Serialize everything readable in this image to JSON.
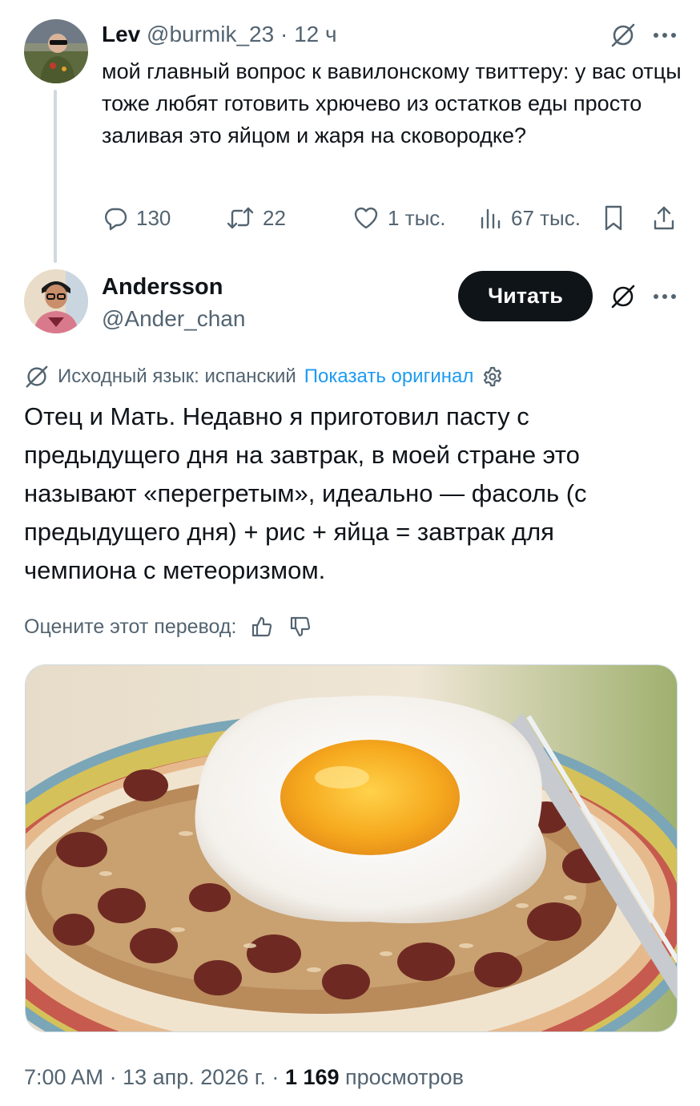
{
  "tweet1": {
    "author_name": "Lev",
    "author_handle": "@burmik_23",
    "separator": "·",
    "time": "12 ч",
    "text": "мой главный вопрос к вавилонскому твиттеру: у вас отцы тоже любят готовить хрючево из остатков еды просто заливая это яйцом и жаря на сковородке?",
    "stats": {
      "replies": "130",
      "reposts": "22",
      "likes": "1 тыс.",
      "views": "67 тыс."
    }
  },
  "tweet2": {
    "author_name": "Andersson",
    "author_handle": "@Ander_chan",
    "follow_label": "Читать",
    "translation_note": "Исходный язык: испанский",
    "show_original": "Показать оригинал",
    "text": "Отец и Мать. Недавно я приготовил пасту с предыдущего дня на завтрак, в моей стране это называют «перегретым», идеально — фасоль (с предыдущего дня) + рис + яйца = завтрак для чемпиона с метеоризмом.",
    "rate_label": "Оцените этот перевод:",
    "time": "7:00 AM",
    "date": "13 апр. 2026 г.",
    "separator": "·",
    "views_count": "1 169",
    "views_label": "просмотров"
  },
  "icons": [
    "grok-icon",
    "more-icon",
    "reply-icon",
    "repost-icon",
    "like-icon",
    "views-icon",
    "bookmark-icon",
    "share-icon",
    "translate-icon",
    "settings-icon",
    "thumbs-up-icon",
    "thumbs-down-icon"
  ],
  "colors": {
    "text": "#0f1419",
    "muted": "#536471",
    "link": "#1d9bf0",
    "button_bg": "#0f1419",
    "thread_line": "#cfd9de"
  }
}
